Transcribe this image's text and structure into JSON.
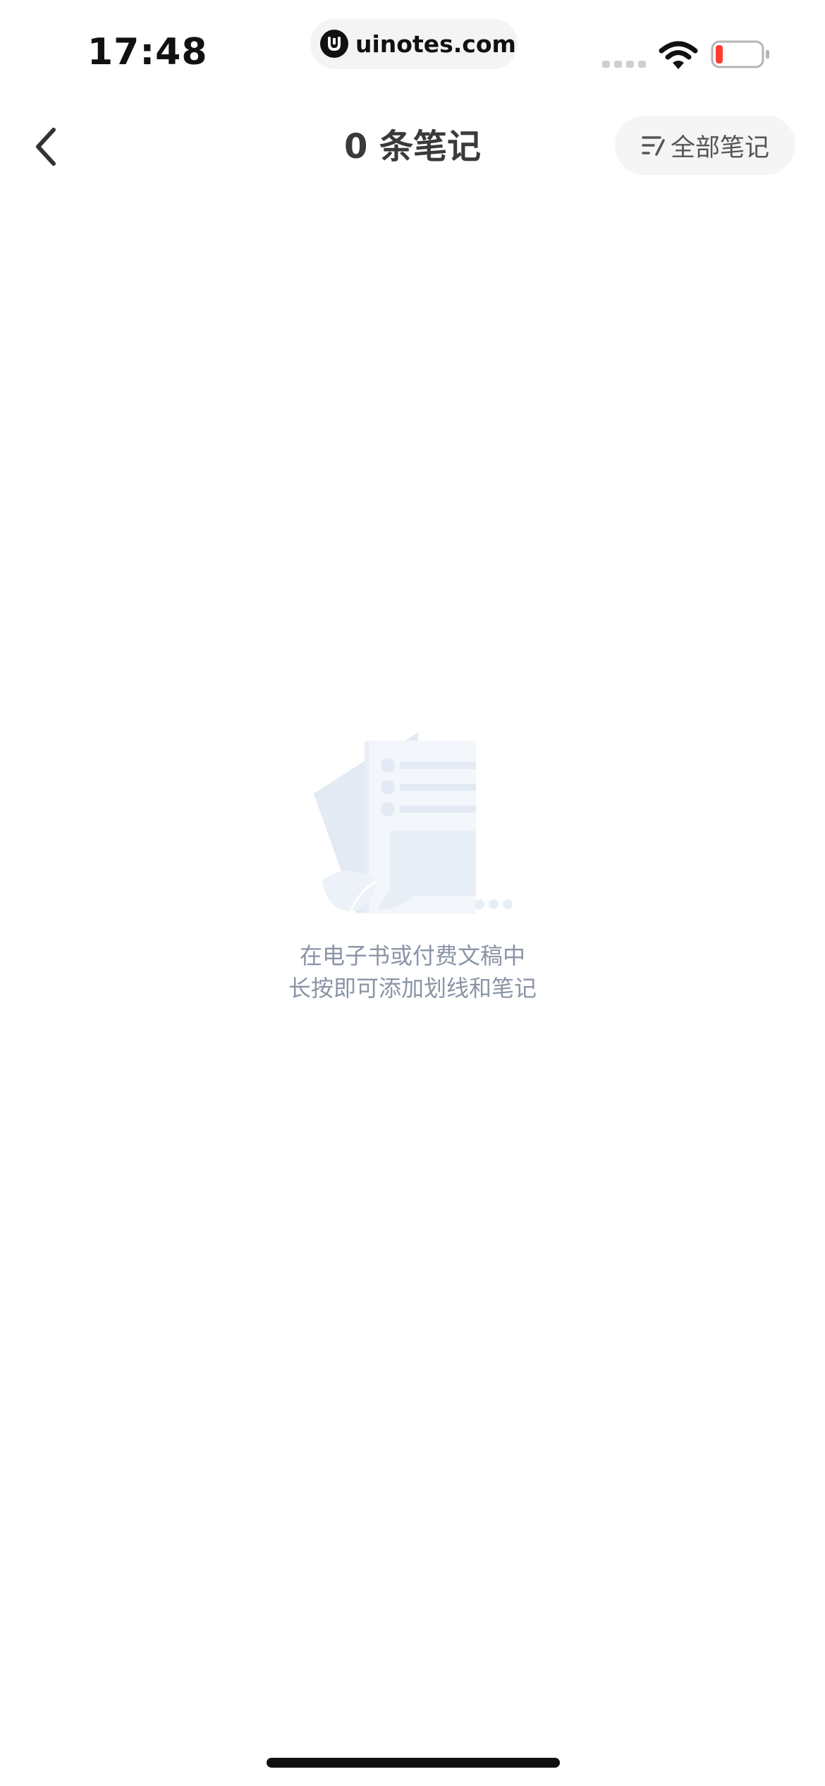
{
  "status_bar": {
    "time": "17:48",
    "url": "uinotes.com",
    "battery_level": 0.1,
    "icons": [
      "signal-icon",
      "wifi-icon",
      "battery-icon"
    ]
  },
  "nav": {
    "back_icon": "chevron-left-icon",
    "title": "0 条笔记",
    "filter_label": "全部笔记",
    "filter_icon": "filter-list-icon"
  },
  "empty_state": {
    "illustration": "empty-notes-illustration",
    "line1": "在电子书或付费文稿中",
    "line2": "长按即可添加划线和笔记"
  },
  "colors": {
    "title_text": "#3a3a3a",
    "hint_text": "#8a94a6",
    "pill_bg": "#f5f5f5",
    "illustration": "#e8eef6",
    "battery_low": "#ff3b30"
  }
}
